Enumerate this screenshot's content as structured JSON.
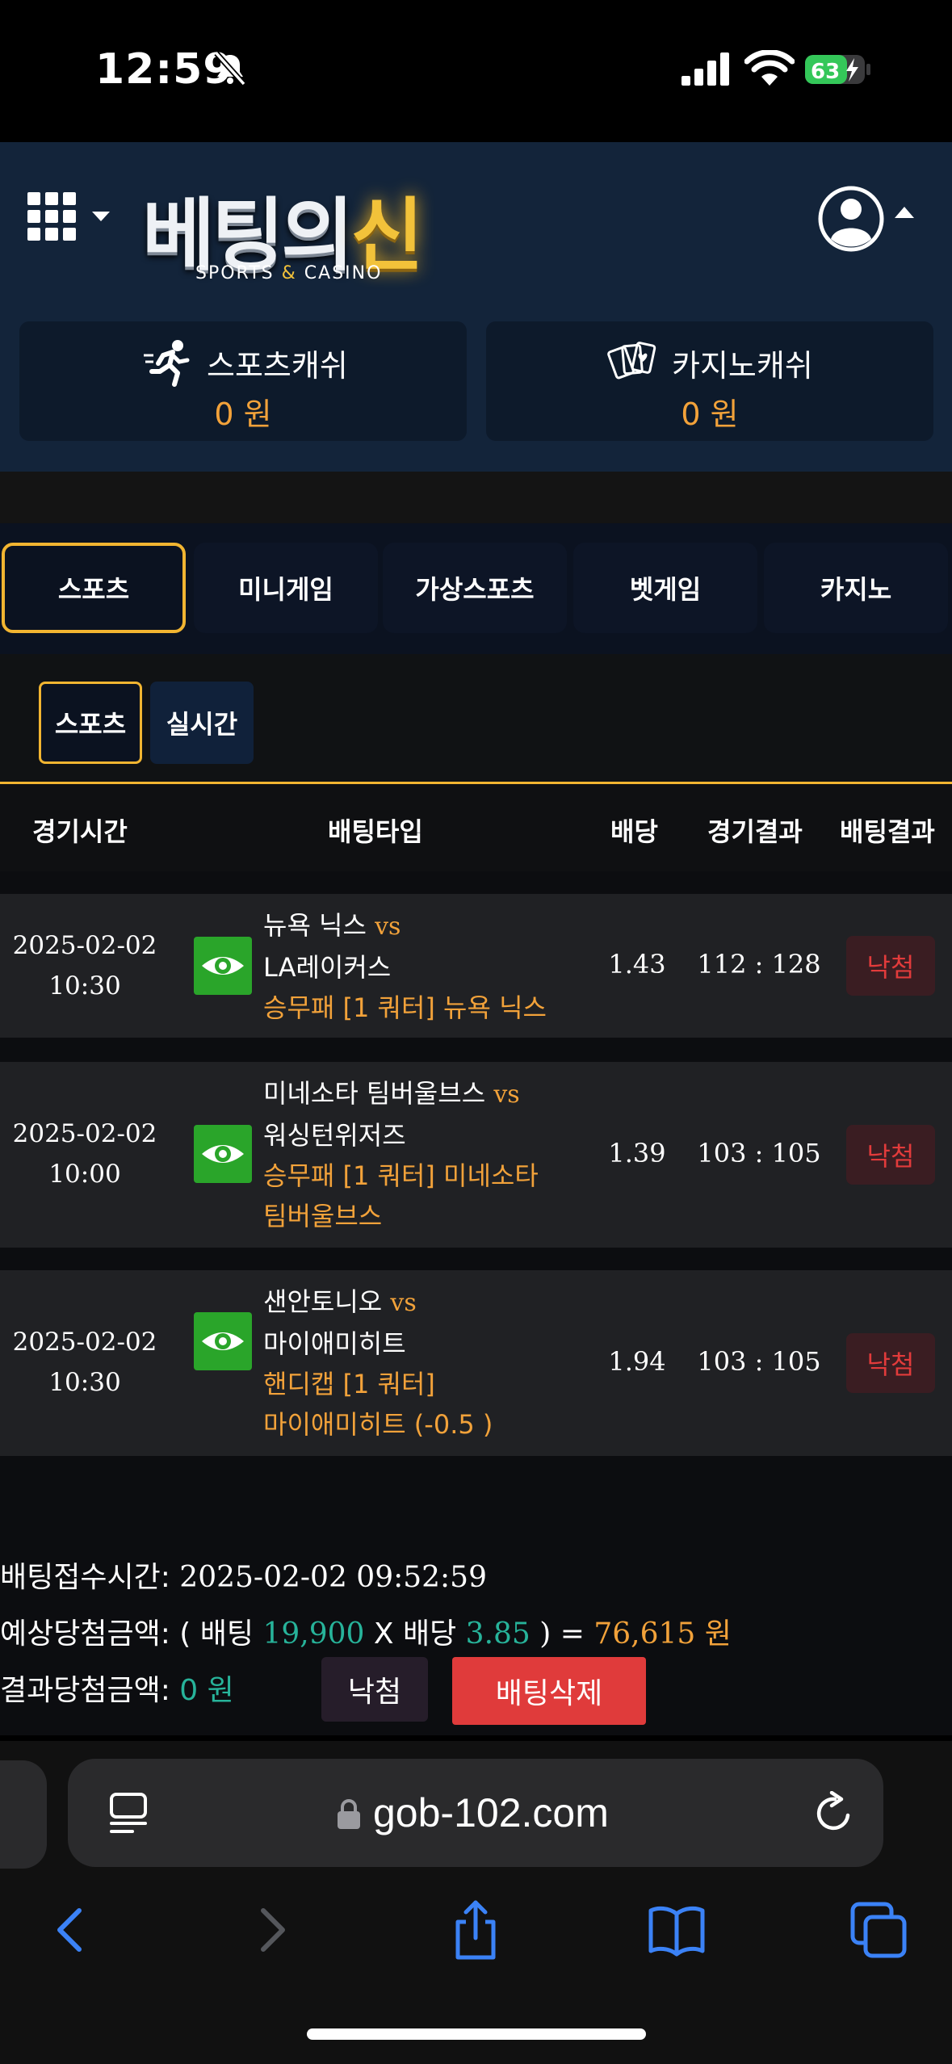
{
  "status_bar": {
    "time": "12:59",
    "battery": "63"
  },
  "header": {
    "logo_text_a": "베팅의",
    "logo_text_b": "신",
    "logo_sub_a": "SPORTS ",
    "logo_sub_amp": "&",
    "logo_sub_b": " CASINO",
    "sports_cash_label": "스포츠캐쉬",
    "sports_cash_value": "0 원",
    "casino_cash_label": "카지노캐쉬",
    "casino_cash_value": "0 원"
  },
  "tabs": [
    "스포츠",
    "미니게임",
    "가상스포츠",
    "벳게임",
    "카지노"
  ],
  "subtabs": [
    "스포츠",
    "실시간"
  ],
  "table": {
    "headers": [
      "경기시간",
      "배팅타입",
      "배당",
      "경기결과",
      "배팅결과"
    ],
    "rows": [
      {
        "date": "2025-02-02",
        "time": "10:30",
        "home": "뉴욕 닉스",
        "vs": "vs",
        "away": "LA레이커스",
        "bet_line1": "승무패 [1 쿼터] 뉴욕 닉스",
        "bet_line2": "",
        "odds": "1.43",
        "score": "112 : 128",
        "result": "낙첨"
      },
      {
        "date": "2025-02-02",
        "time": "10:00",
        "home": "미네소타 팀버울브스",
        "vs": "vs",
        "away": "워싱턴위저즈",
        "bet_line1": "승무패 [1 쿼터] 미네소타",
        "bet_line2": "팀버울브스",
        "odds": "1.39",
        "score": "103 : 105",
        "result": "낙첨"
      },
      {
        "date": "2025-02-02",
        "time": "10:30",
        "home": "샌안토니오",
        "vs": "vs",
        "away": "마이애미히트",
        "bet_line1": "핸디캡 [1 쿼터]",
        "bet_line2": "마이애미히트 (-0.5 )",
        "odds": "1.94",
        "score": "103 : 105",
        "result": "낙첨"
      }
    ]
  },
  "summary": {
    "accept_label": "배팅접수시간: ",
    "accept_value": "2025-02-02 09:52:59",
    "expected_label": "예상당첨금액: ( 배팅 ",
    "stake": "19,900",
    "times": " X 배당 ",
    "total_odds": "3.85",
    "close": " ) = ",
    "expected_win": "76,615 원",
    "result_label": "결과당첨금액: ",
    "result_value": "0 원",
    "lose_button": "낙첨",
    "delete_button": "배팅삭제"
  },
  "browser": {
    "url": "gob-102.com"
  },
  "colors": {
    "accent_gold": "#f2b531",
    "win_orange": "#f2a23a",
    "lose_red": "#e23b3b",
    "teal": "#27b39a",
    "header_navy": "#13243a"
  }
}
